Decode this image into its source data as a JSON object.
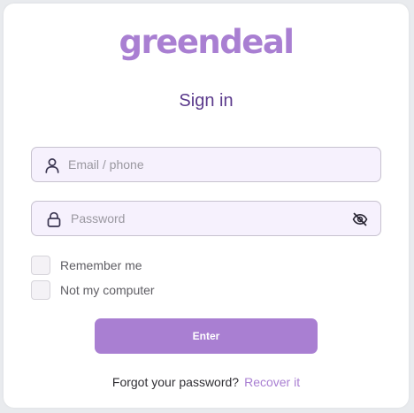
{
  "brand": {
    "logo_text": "greendeal",
    "color": "#a97fd2"
  },
  "form": {
    "title": "Sign in",
    "email": {
      "placeholder": "Email / phone",
      "icon": "user-icon"
    },
    "password": {
      "placeholder": "Password",
      "icon": "lock-icon",
      "toggle_icon": "eye-off-icon"
    },
    "remember_label": "Remember me",
    "not_my_computer_label": "Not my computer",
    "submit_label": "Enter",
    "forgot_text": "Forgot your password?",
    "recover_link": "Recover it"
  },
  "colors": {
    "accent": "#a97fd2",
    "title": "#5b3a8c",
    "field_bg": "#f6f1fd"
  }
}
